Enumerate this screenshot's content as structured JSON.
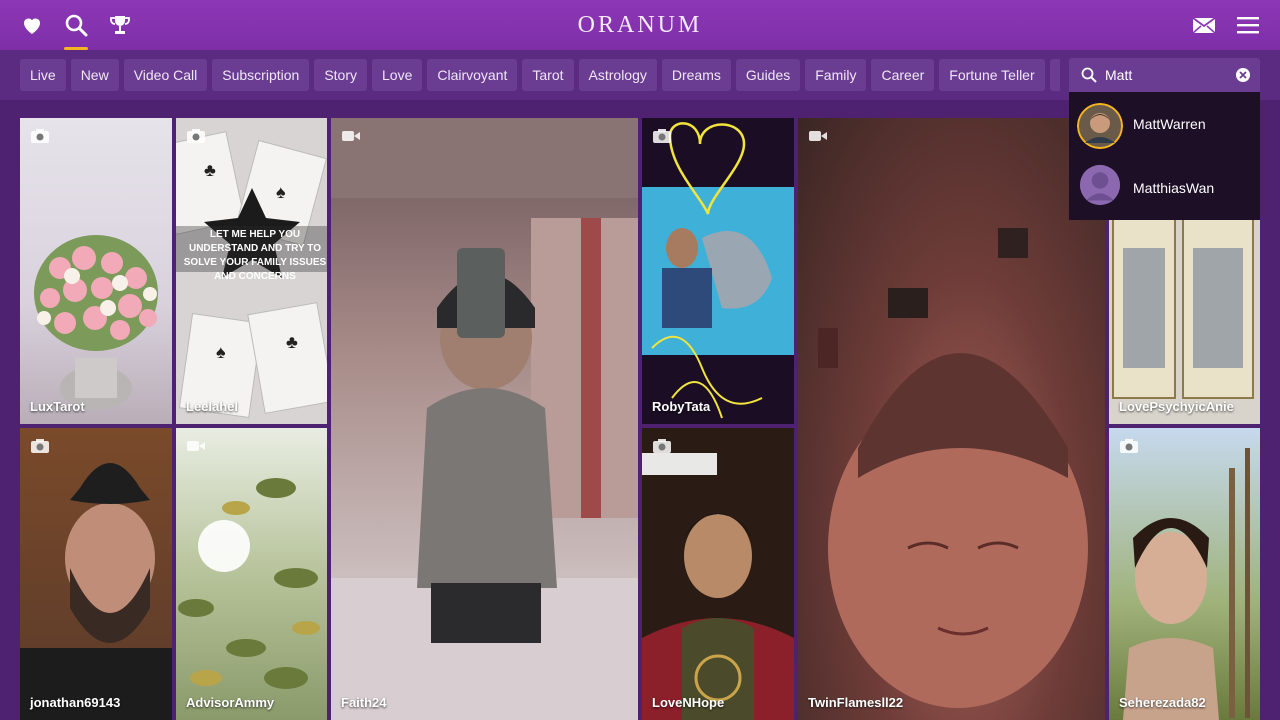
{
  "header": {
    "logo": "Oranum",
    "icons": [
      "heart-icon",
      "search-icon",
      "trophy-icon",
      "mail-icon",
      "menu-icon"
    ]
  },
  "filters": [
    "Live",
    "New",
    "Video Call",
    "Subscription",
    "Story",
    "Love",
    "Clairvoyant",
    "Tarot",
    "Astrology",
    "Dreams",
    "Guides",
    "Family",
    "Career",
    "Fortune Teller"
  ],
  "search": {
    "value": "Matt",
    "results": [
      "MattWarren",
      "MatthiasWan"
    ]
  },
  "grid": [
    {
      "name": "LuxTarot",
      "media": "camera-icon"
    },
    {
      "name": "Leelahel",
      "media": "camera-icon",
      "overlay_text": "LET ME HELP YOU UNDERSTAND AND TRY TO SOLVE YOUR FAMILY ISSUES AND CONCERNS"
    },
    {
      "name": "Faith24",
      "media": "video-icon"
    },
    {
      "name": "RobyTata",
      "media": "camera-icon"
    },
    {
      "name": "TwinFlamesll22",
      "media": "video-icon"
    },
    {
      "name": "LovePsychyicAnie",
      "media": "camera-icon"
    },
    {
      "name": "jonathan69143",
      "media": "camera-icon"
    },
    {
      "name": "AdvisorAmmy",
      "media": "video-icon"
    },
    {
      "name": "LoveNHope",
      "media": "camera-icon"
    },
    {
      "name": "Seherezada82",
      "media": "camera-icon"
    }
  ],
  "colors": {
    "header": "#8d37b6",
    "background": "#4e2270",
    "chip": "#6a3d93",
    "accent": "#f4b520",
    "dropdown": "#1d0f26"
  }
}
